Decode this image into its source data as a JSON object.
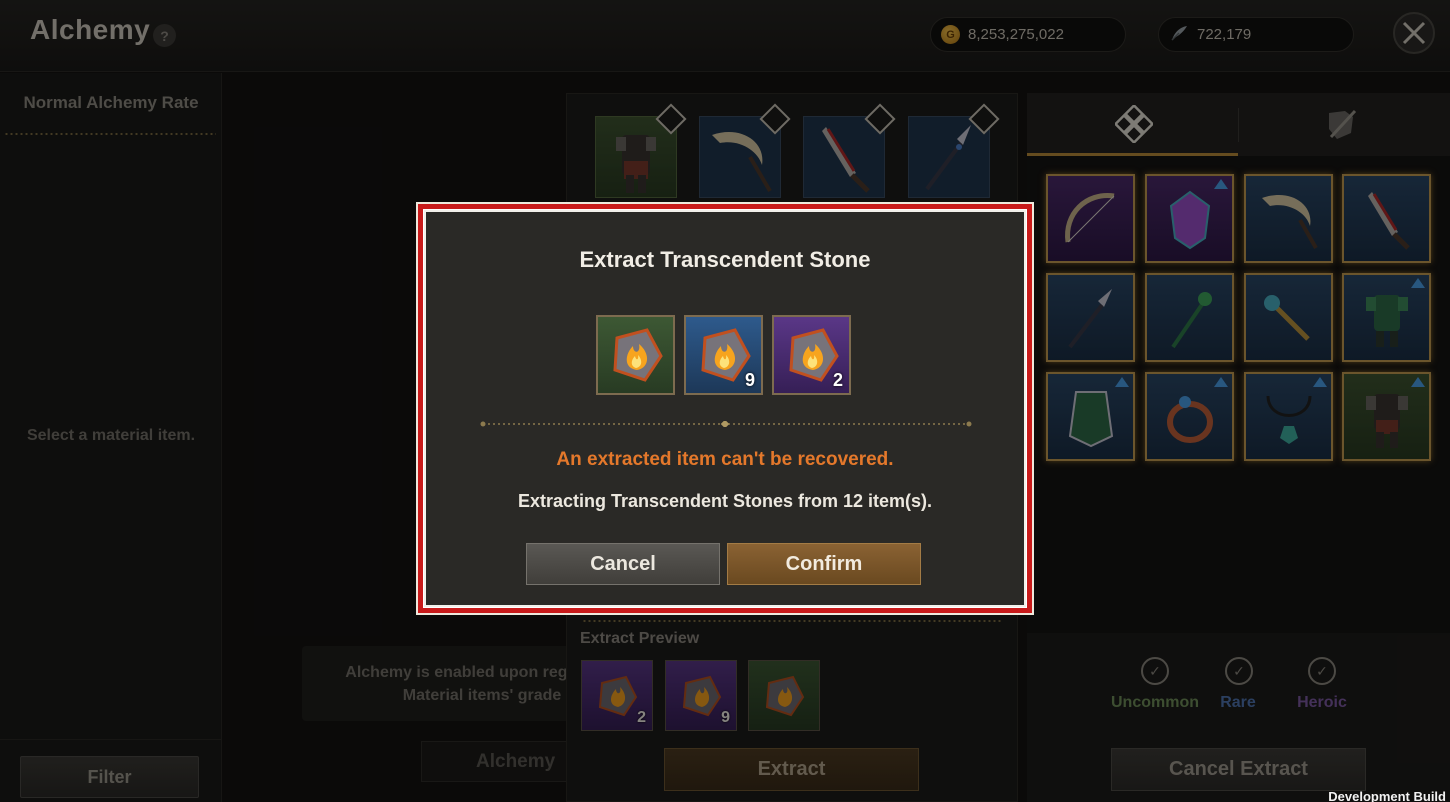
{
  "header": {
    "title": "Alchemy",
    "help_label": "?",
    "gold_amount": "8,253,275,022",
    "feather_amount": "722,179",
    "coin_symbol": "G"
  },
  "left_panel": {
    "rate_title": "Normal Alchemy Rate",
    "hint": "Select a material item.",
    "filter_label": "Filter"
  },
  "center": {
    "info_line1": "Alchemy is enabled upon regi",
    "info_line2": "Material items' grade r",
    "alchemy_button": "Alchemy"
  },
  "extract_panel": {
    "preview_label": "Extract Preview",
    "preview_items": [
      {
        "color": "purple",
        "count": "2"
      },
      {
        "color": "blue",
        "count": "9"
      },
      {
        "color": "green",
        "count": ""
      }
    ],
    "extract_button": "Extract"
  },
  "right_panel": {
    "grades": [
      {
        "label": "Uncommon",
        "color": "#6f8f5a"
      },
      {
        "label": "Rare",
        "color": "#4f74b0"
      },
      {
        "label": "Heroic",
        "color": "#7d5aa3"
      }
    ],
    "cancel_extract_button": "Cancel Extract"
  },
  "modal": {
    "title": "Extract Transcendent Stone",
    "stones": [
      {
        "color": "green",
        "count": ""
      },
      {
        "color": "blue",
        "count": "9"
      },
      {
        "color": "purple",
        "count": "2"
      }
    ],
    "warning": "An extracted item can't be recovered.",
    "description": "Extracting Transcendent Stones from 12 item(s).",
    "cancel_button": "Cancel",
    "confirm_button": "Confirm"
  },
  "footer": {
    "dev_build": "Development Build"
  },
  "colors": {
    "warning": "#e4782b",
    "modal_border": "#c81a1a",
    "slot_glow": "#c49b50"
  }
}
